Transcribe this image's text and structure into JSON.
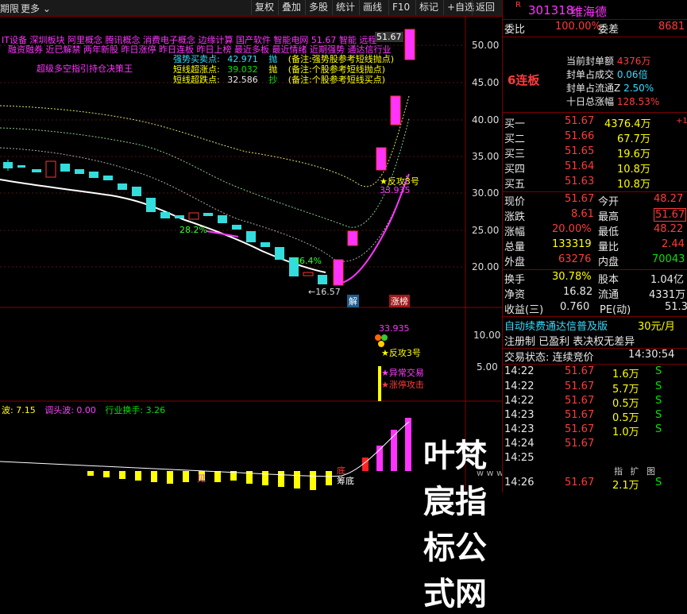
{
  "toolbar": {
    "left_items": [
      "期限",
      "更多"
    ],
    "buttons": [
      "复权",
      "叠加",
      "多股",
      "统计",
      "画线",
      "F10",
      "标记",
      "+自选",
      "返回"
    ]
  },
  "main_chart": {
    "concept_line1": "IT设备  深圳板块  阿里概念  腾讯概念  消费电子概念  边缘计算  国产软件  智能电网  51.67  智能  远程",
    "concept_line2": "融资融券  近已解禁  两年新股  昨日涨停  昨日连板  昨日上榜  最近多板  最近情绪  近期强势  通达信行业",
    "indicator_name": "超级多空指引持仓决策王",
    "price_label": "51.67",
    "rows": [
      {
        "label": "强势买卖点:",
        "value": "42.971",
        "tag": "抛",
        "note": "(备注:强势股参考短线抛点)"
      },
      {
        "label": "短线超涨点:",
        "value": "39.032",
        "tag": "抛",
        "note": "(备注:个股参考短线抛点)"
      },
      {
        "label": "短线超跌点:",
        "value": "32.586",
        "tag": "抄",
        "note": "(备注:个股参考短线买点)"
      }
    ],
    "y_ticks": [
      "50.00",
      "45.00",
      "40.00",
      "35.00",
      "30.00",
      "25.00",
      "20.00"
    ],
    "annotations": {
      "fangong": "反攻3号",
      "fangong_value": "33.935",
      "low_mark": "←16.57",
      "pct1": "28.2%",
      "pct2": "36.4%",
      "jie": "解",
      "zhangbang": "涨榜"
    }
  },
  "sub_chart1": {
    "y_ticks": [
      "10.00",
      "5.00"
    ],
    "value": "33.935",
    "labels": [
      "反攻3号",
      "异常交易",
      "涨停攻击"
    ]
  },
  "sub_chart2": {
    "header_a": "波: 7.15",
    "header_b": "调头波: 0.00",
    "header_c": "行业换手: 3.26",
    "label_bottom": "底",
    "label_bottom2": "筹底",
    "label_left": "见"
  },
  "watermark": {
    "main": "叶梵宸指标公式网",
    "sub": "w w w . y e f a n c h e n . c o m"
  },
  "quote": {
    "code": "301318",
    "name": "维海德",
    "tag": "R",
    "weibi_label": "委比",
    "weibi_value": "100.00%",
    "weicha_label": "委差",
    "weicha_value": "8681",
    "board": "6连板",
    "seal_info": [
      {
        "label": "当前封单额",
        "value": "4376万"
      },
      {
        "label": "封单占成交",
        "value": "0.06倍"
      },
      {
        "label": "封单占流通Z",
        "value": "2.50%"
      },
      {
        "label": "十日总涨幅",
        "value": "128.53%"
      }
    ],
    "bids": [
      {
        "label": "买一",
        "price": "51.67",
        "vol": "4376.4万",
        "chg": "+1"
      },
      {
        "label": "买二",
        "price": "51.66",
        "vol": "67.7万",
        "chg": ""
      },
      {
        "label": "买三",
        "price": "51.65",
        "vol": "19.6万",
        "chg": ""
      },
      {
        "label": "买四",
        "price": "51.64",
        "vol": "10.8万",
        "chg": ""
      },
      {
        "label": "买五",
        "price": "51.63",
        "vol": "10.8万",
        "chg": ""
      }
    ],
    "stats": [
      {
        "l1": "现价",
        "v1": "51.67",
        "l2": "今开",
        "v2": "48.27"
      },
      {
        "l1": "涨跌",
        "v1": "8.61",
        "l2": "最高",
        "v2": "51.67"
      },
      {
        "l1": "涨幅",
        "v1": "20.00%",
        "l2": "最低",
        "v2": "48.22"
      },
      {
        "l1": "总量",
        "v1": "133319",
        "l2": "量比",
        "v2": "2.44"
      },
      {
        "l1": "外盘",
        "v1": "63276",
        "l2": "内盘",
        "v2": "70043"
      }
    ],
    "stats2": [
      {
        "l1": "换手",
        "v1": "30.78%",
        "l2": "股本",
        "v2": "1.04亿"
      },
      {
        "l1": "净资",
        "v1": "16.82",
        "l2": "流通",
        "v2": "4331万"
      },
      {
        "l1": "收益(三)",
        "v1": "0.760",
        "l2": "PE(动)",
        "v2": "51.3"
      }
    ],
    "promo": "自动续费通达信普及版",
    "promo_price": "30元/月",
    "register": "注册制 已盈利 表决权无差异",
    "status_label": "交易状态: 连续竞价",
    "status_time": "14:30:54",
    "trades": [
      {
        "time": "14:22",
        "price": "51.67",
        "vol": "1.6万",
        "dir": "S"
      },
      {
        "time": "14:22",
        "price": "51.67",
        "vol": "5.7万",
        "dir": "S"
      },
      {
        "time": "14:22",
        "price": "51.67",
        "vol": "0.5万",
        "dir": "S"
      },
      {
        "time": "14:23",
        "price": "51.67",
        "vol": "0.5万",
        "dir": "S"
      },
      {
        "time": "14:23",
        "price": "51.67",
        "vol": "1.0万",
        "dir": "S"
      },
      {
        "time": "14:24",
        "price": "51.67",
        "vol": "",
        "dir": ""
      },
      {
        "time": "14:25",
        "price": "",
        "vol": "",
        "dir": ""
      },
      {
        "time": "14:26",
        "price": "51.67",
        "vol": "2.1万",
        "dir": "S"
      }
    ],
    "bottom_tabs": [
      "指",
      "扩",
      "图"
    ]
  }
}
